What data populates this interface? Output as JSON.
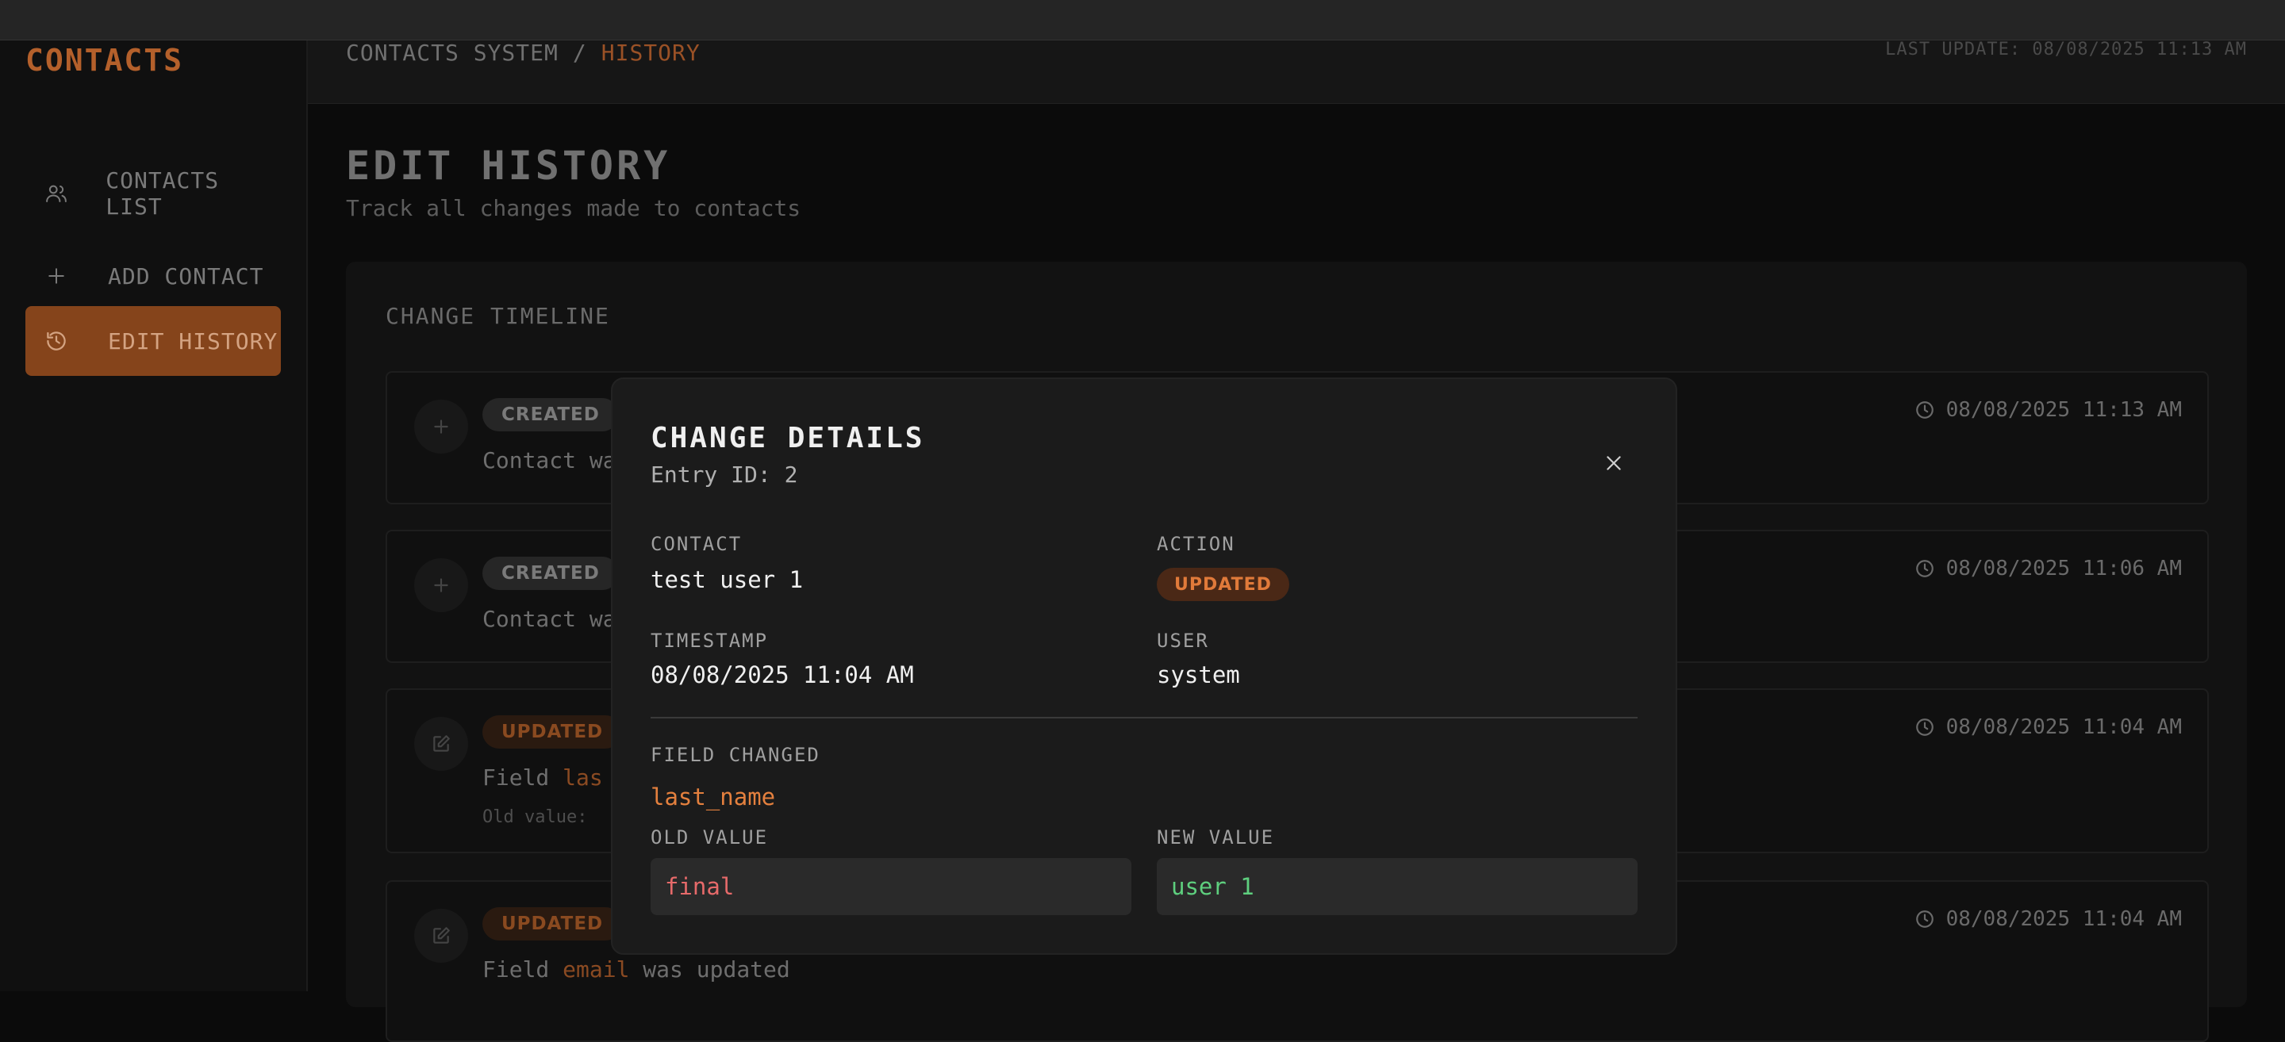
{
  "app": {
    "logo": "CONTACTS"
  },
  "sidebar": {
    "items": [
      {
        "label": "CONTACTS LIST",
        "icon": "users-icon",
        "active": false
      },
      {
        "label": "ADD CONTACT",
        "icon": "plus-icon",
        "active": false
      },
      {
        "label": "EDIT HISTORY",
        "icon": "history-icon",
        "active": true
      }
    ]
  },
  "header": {
    "breadcrumb_root": "CONTACTS SYSTEM",
    "breadcrumb_sep": "/",
    "breadcrumb_current": "HISTORY",
    "last_update": "LAST UPDATE: 08/08/2025 11:13 AM"
  },
  "page": {
    "title": "EDIT HISTORY",
    "subtitle": "Track all changes made to contacts"
  },
  "timeline": {
    "title": "CHANGE TIMELINE",
    "entries": [
      {
        "action": "CREATED",
        "desc": "Contact wa",
        "time": "08/08/2025 11:13 AM"
      },
      {
        "action": "CREATED",
        "desc": "Contact wa",
        "time": "08/08/2025 11:06 AM"
      },
      {
        "action": "UPDATED",
        "desc_prefix": "Field ",
        "field": "las",
        "old_value_label": "Old value:",
        "time": "08/08/2025 11:04 AM"
      },
      {
        "action": "UPDATED",
        "desc_prefix": "Field ",
        "field": "email",
        "desc_suffix": " was updated",
        "time": "08/08/2025 11:04 AM"
      }
    ]
  },
  "modal": {
    "title": "CHANGE DETAILS",
    "entry_id": "Entry ID: 2",
    "contact_label": "CONTACT",
    "contact_value": "test user 1",
    "action_label": "ACTION",
    "action_value": "UPDATED",
    "timestamp_label": "TIMESTAMP",
    "timestamp_value": "08/08/2025 11:04 AM",
    "user_label": "USER",
    "user_value": "system",
    "field_changed_label": "FIELD CHANGED",
    "field_changed_value": "last_name",
    "old_value_label": "OLD VALUE",
    "old_value": "final",
    "new_value_label": "NEW VALUE",
    "new_value": "user 1"
  },
  "colors": {
    "accent": "#85441b",
    "updated_badge_text": "#e07a3a",
    "old_value": "#e66a6a",
    "new_value": "#5ecf7e"
  }
}
